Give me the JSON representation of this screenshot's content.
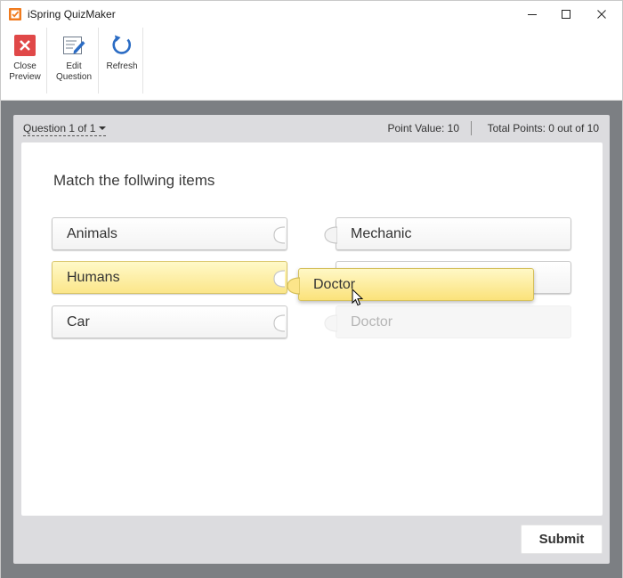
{
  "window": {
    "title": "iSpring QuizMaker"
  },
  "toolbar": {
    "close_preview_line1": "Close",
    "close_preview_line2": "Preview",
    "edit_question_line1": "Edit",
    "edit_question_line2": "Question",
    "refresh_label": "Refresh"
  },
  "quiz": {
    "question_selector": "Question 1 of 1",
    "point_value": "Point Value: 10",
    "total_points": "Total Points: 0 out of 10",
    "question_text": "Match the follwing items",
    "left_items": [
      "Animals",
      "Humans",
      "Car"
    ],
    "right_items": [
      "Mechanic",
      "",
      "Doctor"
    ],
    "dragged_item": "Doctor",
    "submit_label": "Submit"
  },
  "colors": {
    "accent_orange": "#f07b1e",
    "close_red": "#e04848",
    "refresh_blue": "#2b6cc4",
    "highlight_yellow": "#fbe68a",
    "preview_gray": "#7c7f83"
  },
  "icons": [
    "app-icon",
    "minimize-icon",
    "maximize-icon",
    "close-window-icon",
    "close-preview-icon",
    "edit-question-icon",
    "refresh-icon",
    "caret-down-icon",
    "mouse-cursor-icon"
  ]
}
